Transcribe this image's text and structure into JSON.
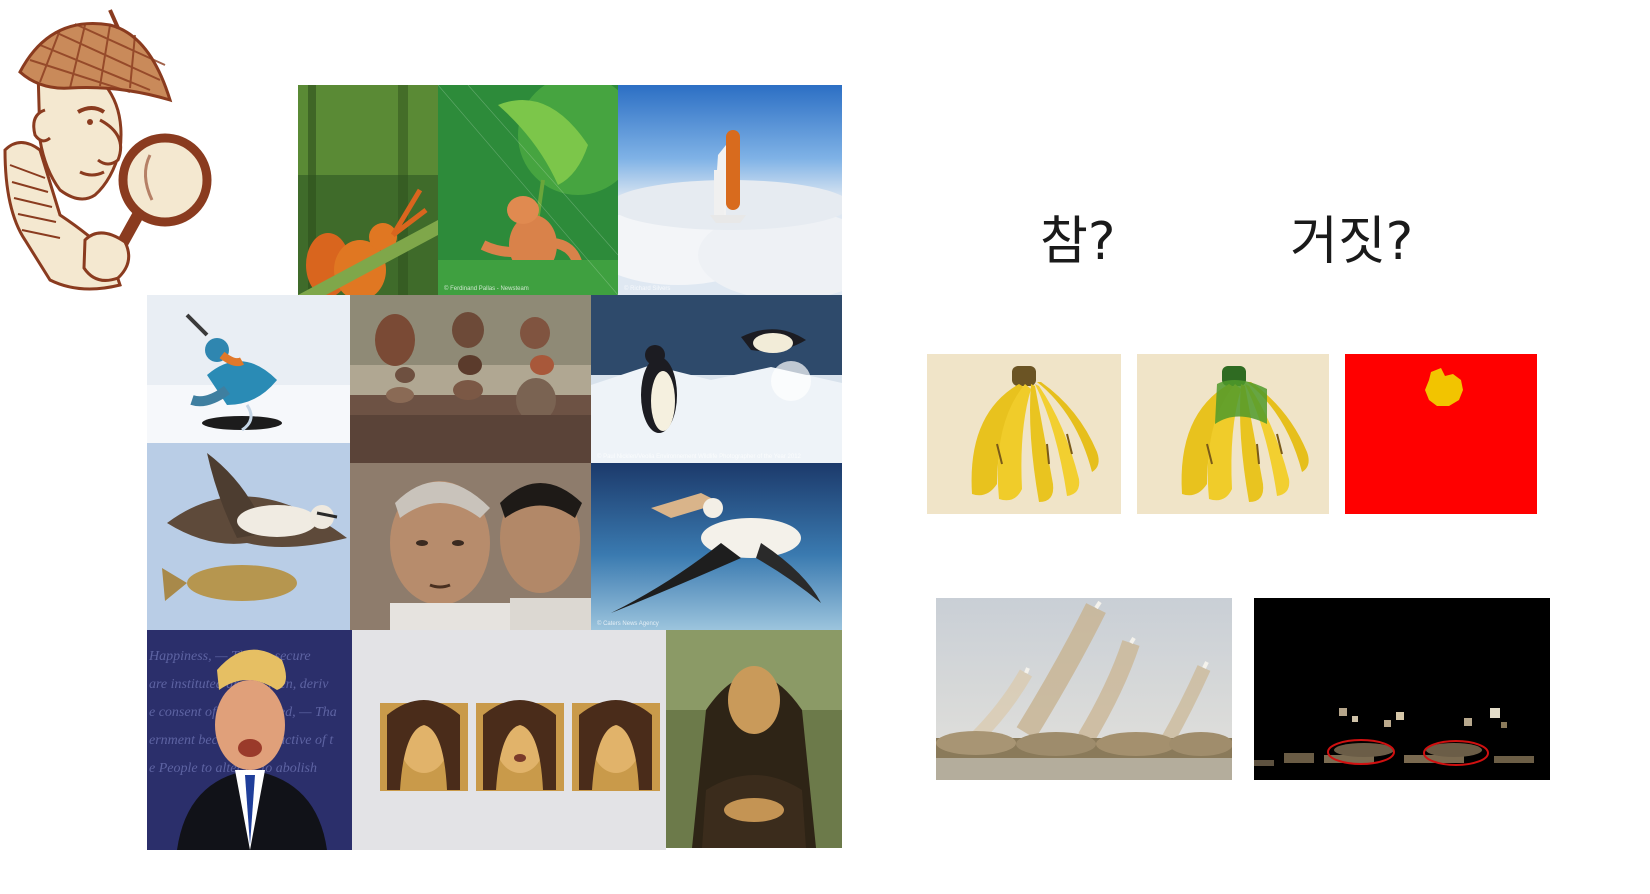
{
  "colors": {
    "detective_brown": "#8a3b1f",
    "detective_cream": "#f4e8d0",
    "mask_red": "#ff0000",
    "mask_yellow": "#f2c400",
    "mask_black": "#000000",
    "highlight_ellipse": "#d01010"
  },
  "detective": {
    "icon": "detective-magnifier-icon"
  },
  "collage": {
    "tiles": [
      {
        "name": "squirrel-photo",
        "caption": ""
      },
      {
        "name": "frog-leaf-photo",
        "caption": "© Ferdinand Pallas - Newsteam"
      },
      {
        "name": "space-shuttle-clouds-photo",
        "caption": "© Richard Silvers"
      },
      {
        "name": "kingfisher-photo",
        "caption": ""
      },
      {
        "name": "stacked-rocks-photo",
        "caption": ""
      },
      {
        "name": "penguins-photo",
        "caption": "© Paul Nicklen/Veolia Environnement Wildlife Photographer of the Year 2012"
      },
      {
        "name": "osprey-fish-photo",
        "caption": ""
      },
      {
        "name": "face-swap-photo",
        "caption": ""
      },
      {
        "name": "pelican-photo",
        "caption": "© Caters News Agency"
      },
      {
        "name": "debate-speaker-photo",
        "caption": ""
      },
      {
        "name": "mona-lisa-frames-photo",
        "caption": ""
      },
      {
        "name": "mona-lisa-painting-photo",
        "caption": ""
      }
    ],
    "debate_background_text": [
      "Happiness, — That to secure",
      "are instituted among Men, deriv",
      "e consent of the governed, — Tha",
      "ernment becomes destructive of t",
      "e People to alter or to abolish"
    ]
  },
  "labels": {
    "true_label": "참?",
    "false_label": "거짓?"
  },
  "bananas": {
    "original": "banana-original-photo",
    "edited": "banana-edited-photo",
    "mask": "banana-mask"
  },
  "missiles": {
    "photo": "missile-launch-photo",
    "mask": "missile-detection-mask"
  }
}
